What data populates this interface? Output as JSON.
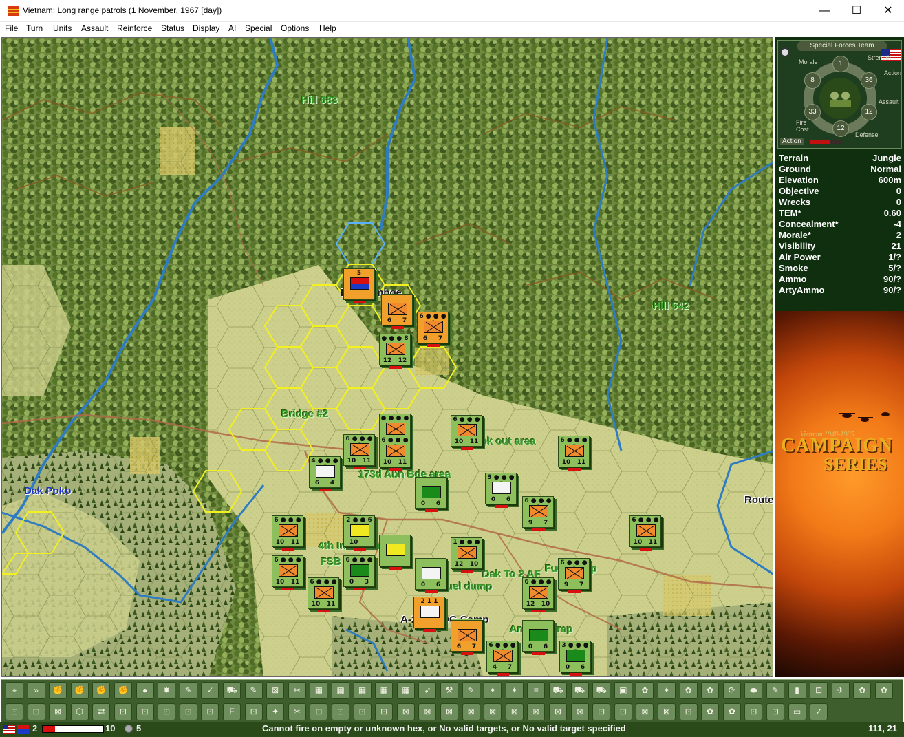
{
  "window": {
    "title": "Vietnam: Long range patrols (1 November, 1967 [day])",
    "minimize": "—",
    "maximize": "☐",
    "close": "✕"
  },
  "menu": [
    "File",
    "Turn",
    "Units",
    "Assault",
    "Reinforce",
    "Status",
    "Display",
    "AI",
    "Special",
    "Options",
    "Help"
  ],
  "map": {
    "places": {
      "hill683": "Hill 683",
      "hill642": "Hill 642",
      "dak_tomboe": "Dak Tomboe",
      "bridge2": "Bridge #2",
      "hook_out": "Hook out area",
      "abn173": "173d Abn Bde area",
      "dak_poko": "Dak Poko",
      "route": "Route",
      "inf4": "4th Inf Div area",
      "fsb1": "FSB 1",
      "dak_to_af": "Dak To 2 AF",
      "fuel1": "Fuel dump",
      "fuel2": "Fuel dump",
      "cidg": "A-244 CIDG Camp",
      "ammo": "Ammo dump"
    },
    "counters": [
      {
        "top": "5",
        "bl": "",
        "br": "",
        "color": "orange",
        "sym": "flag"
      },
      {
        "top": "",
        "bl": "6",
        "br": "7",
        "color": "orange",
        "sym": "inf"
      },
      {
        "top": "6 ● ● ● 4",
        "bl": "6",
        "br": "7",
        "color": "orange",
        "sym": "inf"
      },
      {
        "top": "● ● ● 8",
        "bl": "12",
        "br": "12",
        "color": "green",
        "sym": "inf"
      },
      {
        "top": "● ● ● ●",
        "bl": "10",
        "br": "11",
        "color": "green",
        "sym": "inf"
      },
      {
        "top": "6 ● ● ● 6",
        "bl": "10",
        "br": "11",
        "color": "green",
        "sym": "inf"
      },
      {
        "top": "6 ● ● ● 6",
        "bl": "10",
        "br": "11",
        "color": "green",
        "sym": "inf"
      },
      {
        "top": "6 ● ● ● 6",
        "bl": "10",
        "br": "11",
        "color": "green",
        "sym": "inf"
      },
      {
        "top": "4 ● ● ● 6",
        "bl": "6",
        "br": "4",
        "color": "green",
        "sym": "white"
      },
      {
        "top": "",
        "bl": "0",
        "br": "6",
        "color": "green",
        "sym": "dgreen"
      },
      {
        "top": "3 ● ● ● 6",
        "bl": "0",
        "br": "6",
        "color": "green",
        "sym": "white"
      },
      {
        "top": "6 ● ● ● 6",
        "bl": "9",
        "br": "7",
        "color": "green",
        "sym": "inf"
      },
      {
        "top": "6 ● ● ● 6",
        "bl": "10",
        "br": "11",
        "color": "green",
        "sym": "inf"
      },
      {
        "top": "6 ● ● ● 6",
        "bl": "10",
        "br": "11",
        "color": "green",
        "sym": "inf"
      },
      {
        "top": "2 ● ● 6",
        "bl": "10",
        "br": "",
        "color": "green",
        "sym": "yellow"
      },
      {
        "top": "",
        "bl": "",
        "br": "",
        "color": "green",
        "sym": "yellow"
      },
      {
        "top": "6 ● ● ● 6",
        "bl": "10",
        "br": "11",
        "color": "green",
        "sym": "inf"
      },
      {
        "top": "6 ● ● ● 6",
        "bl": "0",
        "br": "3",
        "color": "green",
        "sym": "dgreen"
      },
      {
        "top": "1 ● ● ● 6",
        "bl": "12",
        "br": "10",
        "color": "green",
        "sym": "inf"
      },
      {
        "top": "",
        "bl": "0",
        "br": "6",
        "color": "green",
        "sym": "white"
      },
      {
        "top": "6 ● ● ● 6",
        "bl": "10",
        "br": "11",
        "color": "green",
        "sym": "inf"
      },
      {
        "top": "2 1 1",
        "bl": "",
        "br": "",
        "color": "orange",
        "sym": "hq"
      },
      {
        "top": "6 ● ● ● 6",
        "bl": "12",
        "br": "10",
        "color": "green",
        "sym": "inf"
      },
      {
        "top": "6 ● ● ● 6",
        "bl": "9",
        "br": "7",
        "color": "green",
        "sym": "inf"
      },
      {
        "top": "6 ● ● ● 6",
        "bl": "10",
        "br": "11",
        "color": "green",
        "sym": "inf"
      },
      {
        "top": "6 ● ● ● 6",
        "bl": "10",
        "br": "11",
        "color": "green",
        "sym": "inf"
      },
      {
        "top": "",
        "bl": "6",
        "br": "7",
        "color": "orange",
        "sym": "inf"
      },
      {
        "top": "6 ● ● ● 6",
        "bl": "4",
        "br": "7",
        "color": "green",
        "sym": "inf"
      },
      {
        "top": "",
        "bl": "0",
        "br": "6",
        "color": "green",
        "sym": "dgreen"
      },
      {
        "top": "3 ● ● ● 6",
        "bl": "0",
        "br": "6",
        "color": "green",
        "sym": "dgreen"
      }
    ]
  },
  "unit": {
    "name": "Special Forces Team",
    "labels": {
      "strength": "Strength",
      "morale": "Morale",
      "action": "Action",
      "assault": "Assault",
      "fire_cost": "Fire Cost",
      "defense": "Defense"
    },
    "values": {
      "strength": "1",
      "morale": "8",
      "action": "36",
      "assault": "12",
      "fire": "33",
      "defense": "12"
    },
    "action_label": "Action",
    "action_level": 0.62
  },
  "terrain": [
    {
      "key": "Terrain",
      "value": "Jungle"
    },
    {
      "key": "Ground",
      "value": "Normal"
    },
    {
      "key": "Elevation",
      "value": "600m"
    },
    {
      "key": "Objective",
      "value": "0"
    },
    {
      "key": "Wrecks",
      "value": "0"
    },
    {
      "key": "TEM*",
      "value": "0.60"
    },
    {
      "key": "Concealment*",
      "value": "-4"
    },
    {
      "key": "Morale*",
      "value": "2"
    },
    {
      "key": "Visibility",
      "value": "21"
    },
    {
      "key": "Air Power",
      "value": "1/?"
    },
    {
      "key": "Smoke",
      "value": "5/?"
    },
    {
      "key": "Ammo",
      "value": "90/?"
    },
    {
      "key": "ArtyAmmo",
      "value": "90/?"
    }
  ],
  "logo": {
    "small": "Vietnam 1948-1985",
    "line1": "CAMPAIGN",
    "line2": "SERIES"
  },
  "toolbar1": [
    "⌖",
    "»",
    "✊",
    "✊",
    "✊",
    "✊",
    "●",
    "✸",
    "✎",
    "✓",
    "⛟",
    "✎",
    "⊠",
    "✂",
    "▦",
    "▦",
    "▦",
    "▦",
    "▦",
    "➶",
    "⚒",
    "✎",
    "✦",
    "✦",
    "≡",
    "⛟",
    "⛟",
    "⛟",
    "▣",
    "✿",
    "✦",
    "✿",
    "✿",
    "⟳",
    "⬬",
    "✎",
    "▮",
    "⊡",
    "✈",
    "✿",
    "✿"
  ],
  "toolbar2": [
    "⊡",
    "⊡",
    "⊠",
    "⬡",
    "⇄",
    "⊡",
    "⊡",
    "⊡",
    "⊡",
    "⊡",
    "F",
    "⊡",
    "✦",
    "✂",
    "⊡",
    "⊡",
    "⊡",
    "⊡",
    "⊠",
    "⊠",
    "⊠",
    "⊠",
    "⊠",
    "⊠",
    "⊠",
    "⊠",
    "⊠",
    "⊡",
    "⊡",
    "⊠",
    "⊠",
    "⊡",
    "✿",
    "✿",
    "⊡",
    "⊡",
    "▭",
    "✓"
  ],
  "status": {
    "turn": "2",
    "turn_max": "10",
    "turn_fraction": 0.2,
    "visibility": "5",
    "message": "Cannot fire on empty or unknown hex, or No valid targets, or No valid target specified",
    "coords": "111, 21"
  },
  "colors": {
    "jungle": "#5e7a36",
    "clear": "#cfd08a",
    "river": "#3a84c8",
    "panel_bg": "#0f2f0f",
    "toolbar_bg": "#3e5e2e"
  }
}
